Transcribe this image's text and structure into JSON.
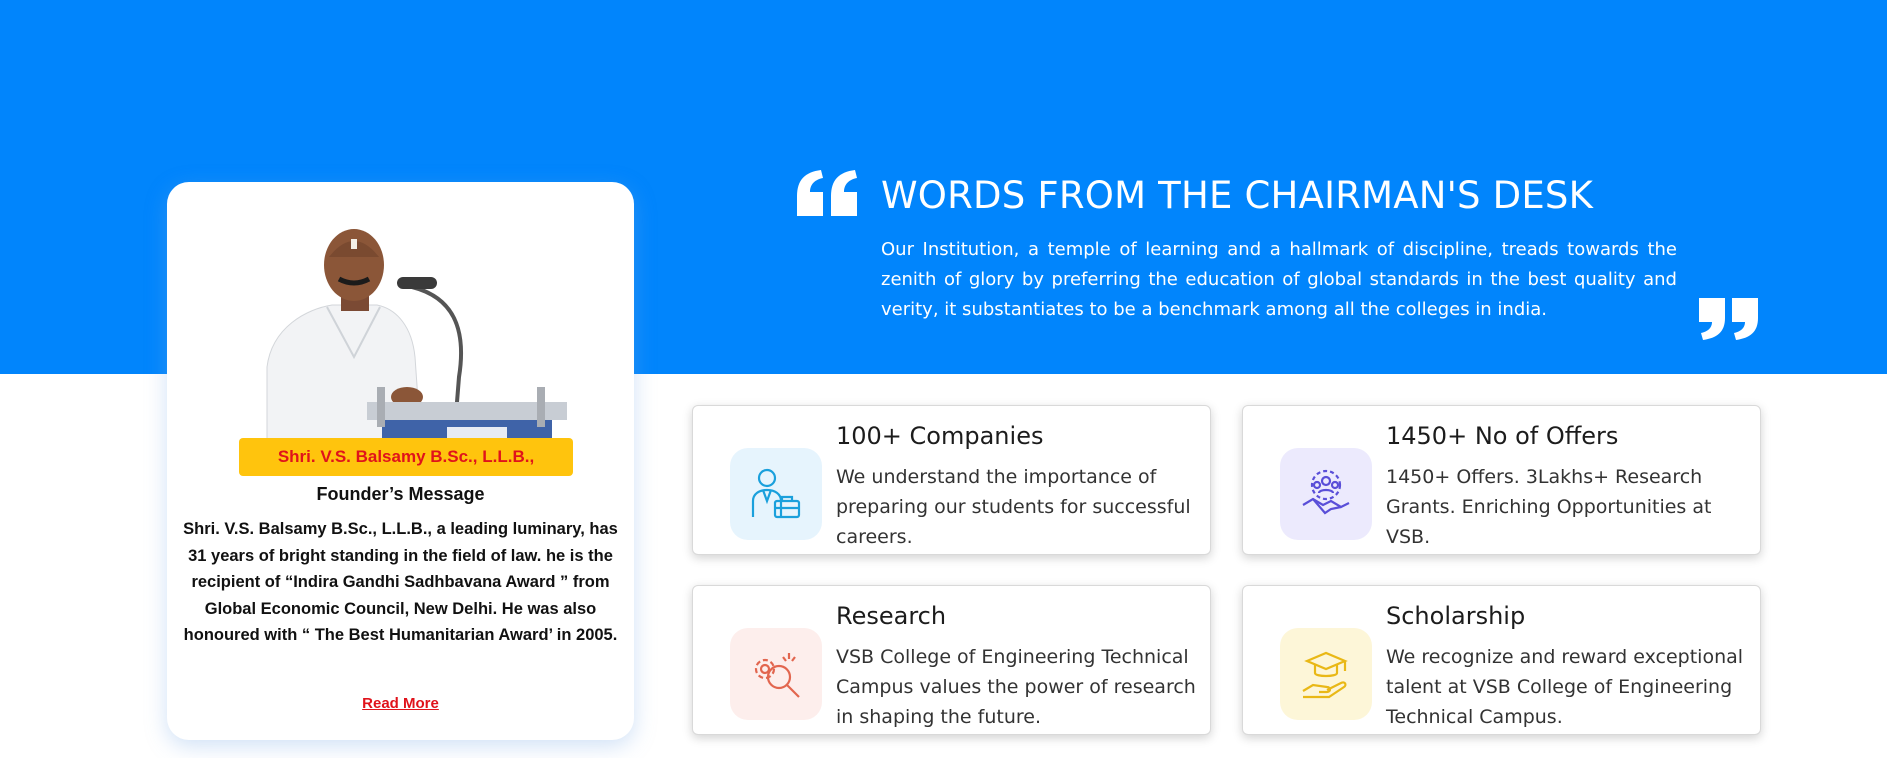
{
  "founder": {
    "name_banner": "Shri. V.S. Balsamy B.Sc., L.L.B.,",
    "title": "Founder’s Message",
    "text": "Shri. V.S. Balsamy B.Sc., L.L.B., a leading luminary, has 31 years of bright standing in the field of law. he is the recipient of “Indira Gandhi Sadhbavana Award ” from Global Economic Council, New Delhi. He was also honoured with “ The Best Humanitarian Award’ in 2005.",
    "read_more": "Read More"
  },
  "chairman": {
    "title": "WORDS FROM THE CHAIRMAN'S DESK",
    "text": "Our Institution, a temple of learning and a hallmark of discipline, treads towards the zenith of glory by preferring the education of global standards in the best quality and verity, it substantiates to be a benchmark among all the colleges in india."
  },
  "stats": [
    {
      "title": "100+ Companies",
      "text": "We understand the importance of preparing our students for successful careers.",
      "icon": "businessman-briefcase-icon",
      "icon_bg": "#e6f4fd",
      "icon_color": "#1aa0dc"
    },
    {
      "title": "1450+ No of Offers",
      "text": "1450+ Offers. 3Lakhs+ Research Grants. Enriching Opportunities at VSB.",
      "icon": "team-handshake-icon",
      "icon_bg": "#eceafd",
      "icon_color": "#5a4fd8"
    },
    {
      "title": "Research",
      "text": "VSB College of Engineering Technical Campus values the power of research in shaping the future.",
      "icon": "gear-magnifier-icon",
      "icon_bg": "#fdeeec",
      "icon_color": "#e2664f"
    },
    {
      "title": "Scholarship",
      "text": "We recognize and reward exceptional talent at VSB College of Engineering Technical Campus.",
      "icon": "graduation-cap-hand-icon",
      "icon_bg": "#fdf6d8",
      "icon_color": "#e9b816"
    }
  ],
  "colors": {
    "primary_blue": "#0185fc",
    "banner_yellow": "#ffc40d",
    "accent_red": "#e0131b"
  }
}
